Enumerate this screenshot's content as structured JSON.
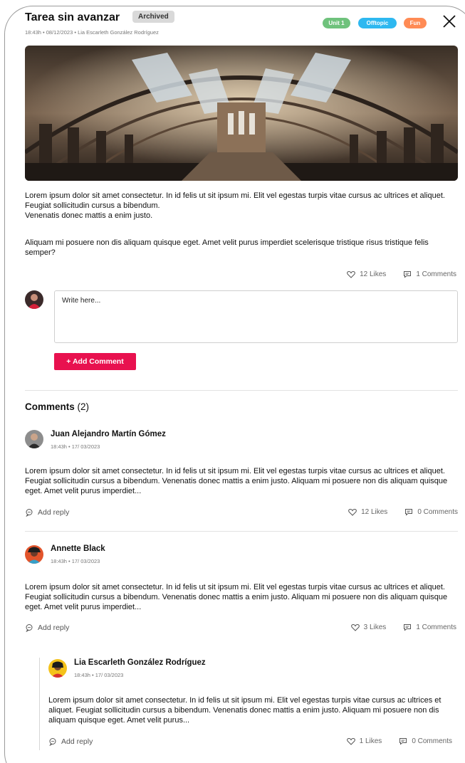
{
  "post": {
    "title": "Tarea sin avanzar",
    "status_badge": "Archived",
    "meta": "18:43h • 08/12/2023 • Lia Escarleth González Rodríguez",
    "tags": [
      "Unit 1",
      "Offtopic",
      "Fun"
    ],
    "tag_colors": [
      "#6fc27c",
      "#2eb8f0",
      "#ff8b55"
    ],
    "paragraph_1": "Lorem ipsum dolor sit amet consectetur. In id felis ut sit ipsum mi. Elit vel egestas turpis vitae cursus ac ultrices et aliquet. Feugiat sollicitudin cursus a bibendum.",
    "paragraph_1b": "Venenatis donec mattis a enim justo.",
    "paragraph_2": "Aliquam mi posuere non dis aliquam quisque eget. Amet velit purus imperdiet scelerisque tristique risus tristique felis semper?",
    "likes": "12 Likes",
    "comments": "1 Comments"
  },
  "composer": {
    "placeholder": "Write here...",
    "add_button": "+ Add Comment",
    "accent": "#e8114f"
  },
  "comments_section": {
    "title": "Comments",
    "count": "(2)"
  },
  "comment_list": [
    {
      "author": "Juan Alejandro Martín Gómez",
      "meta": "18:43h • 17/ 03/2023",
      "text": "Lorem ipsum dolor sit amet consectetur. In id felis ut sit ipsum mi. Elit vel egestas turpis vitae cursus ac ultrices et aliquet. Feugiat sollicitudin cursus a bibendum. Venenatis donec mattis a enim justo. Aliquam mi posuere non dis aliquam quisque eget. Amet velit purus imperdiet...",
      "reply_label": "Add reply",
      "likes": "12 Likes",
      "comments": "0 Comments"
    },
    {
      "author": "Annette Black",
      "meta": "18:43h • 17/ 03/2023",
      "text": "Lorem ipsum dolor sit amet consectetur. In id felis ut sit ipsum mi. Elit vel egestas turpis vitae cursus ac ultrices et aliquet. Feugiat sollicitudin cursus a bibendum. Venenatis donec mattis a enim justo. Aliquam mi posuere non dis aliquam quisque eget. Amet velit purus imperdiet...",
      "reply_label": "Add reply",
      "likes": "3 Likes",
      "comments": "1 Comments"
    }
  ],
  "reply": {
    "author": "Lia Escarleth González Rodríguez",
    "meta": "18:43h • 17/ 03/2023",
    "text": "Lorem ipsum dolor sit amet consectetur. In id felis ut sit ipsum mi. Elit vel egestas turpis vitae cursus ac ultrices et aliquet. Feugiat sollicitudin cursus a bibendum. Venenatis donec mattis a enim justo. Aliquam mi posuere non dis aliquam quisque eget. Amet velit purus...",
    "reply_label": "Add reply",
    "likes": "1 Likes",
    "comments": "0 Comments"
  }
}
